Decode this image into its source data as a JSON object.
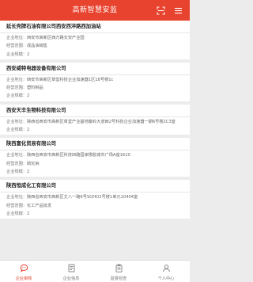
{
  "header": {
    "title": "高新智慧安监"
  },
  "companies": [
    {
      "name": "延长壳牌石油有限公司西安西沣路西加油站",
      "rows": [
        {
          "label": "企业地址：",
          "value": "西安市高新区西万路长安产业园"
        },
        {
          "label": "经营范围：",
          "value": "成品油销售"
        },
        {
          "label": "企业规模：",
          "value": "2"
        }
      ]
    },
    {
      "name": "西安威特电器设备有限公司",
      "rows": [
        {
          "label": "企业地址：",
          "value": "西安市高新区草堂科技企业加速器1区18号楼1c"
        },
        {
          "label": "经营范围：",
          "value": "塑料制品"
        },
        {
          "label": "企业规模：",
          "value": "2"
        }
      ]
    },
    {
      "name": "西安天丰生物科技有限公司",
      "rows": [
        {
          "label": "企业地址：",
          "value": "陕西省西安市高新区草堂产业基地秦岭大道西2号科技企业加速器一期6号楼2C3室"
        },
        {
          "label": "企业规模：",
          "value": "2"
        }
      ]
    },
    {
      "name": "陕西富化贸易有限公司",
      "rows": [
        {
          "label": "企业地址：",
          "value": "陕西省西安市高新区科技四路国家橡胶城市广场A座1610"
        },
        {
          "label": "经营范围：",
          "value": "硫化钠"
        },
        {
          "label": "企业规模：",
          "value": "2"
        }
      ]
    },
    {
      "name": "陕西恒成化工有限公司",
      "rows": [
        {
          "label": "企业地址：",
          "value": "陕西省西安市高新区丈八一路6号SOHO1号楼1单元10404室"
        },
        {
          "label": "经营范围：",
          "value": "化工产品批发"
        },
        {
          "label": "企业规模：",
          "value": "2"
        }
      ]
    }
  ],
  "tabs": [
    {
      "label": "企业审核",
      "icon": "chat-bubble-icon",
      "active": true
    },
    {
      "label": "企业信息",
      "icon": "document-icon",
      "active": false
    },
    {
      "label": "监督检查",
      "icon": "clipboard-icon",
      "active": false
    },
    {
      "label": "个人中心",
      "icon": "person-icon",
      "active": false
    }
  ],
  "colors": {
    "primary": "#e8432f",
    "inactive": "#777777"
  }
}
